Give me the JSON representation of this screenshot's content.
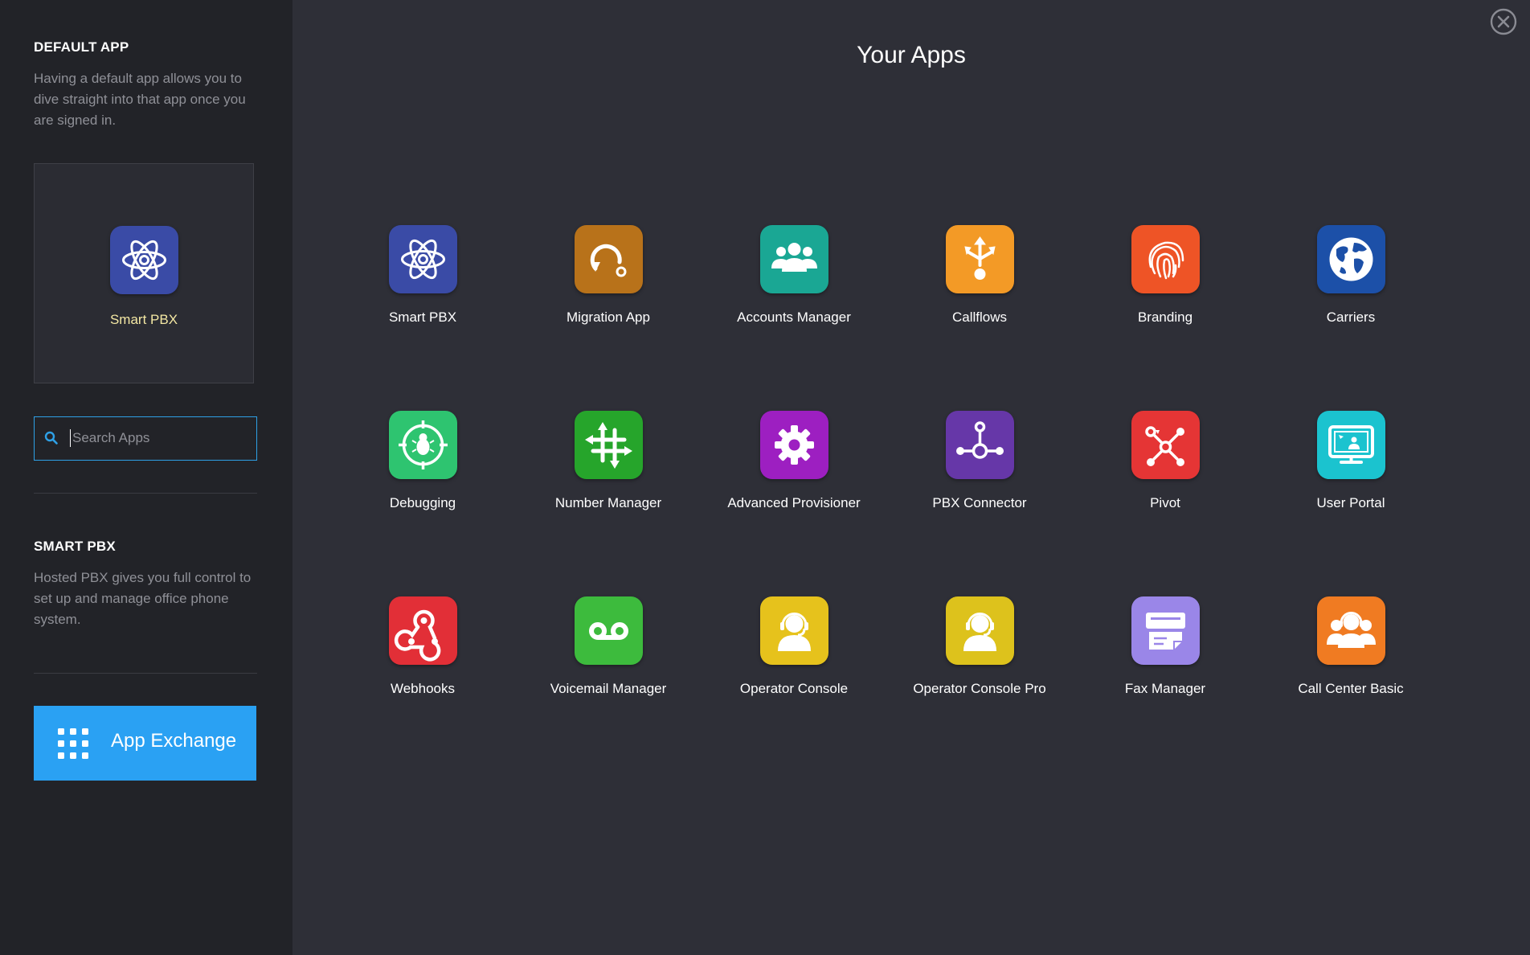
{
  "sidebar": {
    "default_heading": "DEFAULT APP",
    "default_description": "Having a default app allows you to dive straight into that app once you are signed in.",
    "default_app": {
      "label": "Smart PBX",
      "icon": "atom-icon",
      "color": "#3a4ba6"
    },
    "search": {
      "placeholder": "Search Apps",
      "value": ""
    },
    "info_heading": "SMART PBX",
    "info_description": "Hosted PBX gives you full control to set up and manage office phone system.",
    "exchange_label": "App Exchange"
  },
  "main": {
    "title": "Your Apps",
    "apps": [
      {
        "label": "Smart PBX",
        "icon": "atom-icon",
        "color": "#3a4ba6"
      },
      {
        "label": "Migration App",
        "icon": "migration-icon",
        "color": "#b8721a"
      },
      {
        "label": "Accounts Manager",
        "icon": "users-icon",
        "color": "#1aa794"
      },
      {
        "label": "Callflows",
        "icon": "callflow-icon",
        "color": "#f39a26"
      },
      {
        "label": "Branding",
        "icon": "fingerprint-icon",
        "color": "#ee5426"
      },
      {
        "label": "Carriers",
        "icon": "globe-icon",
        "color": "#1c50a8"
      },
      {
        "label": "Debugging",
        "icon": "bug-target-icon",
        "color": "#2ec470"
      },
      {
        "label": "Number Manager",
        "icon": "hash-icon",
        "color": "#26a52b"
      },
      {
        "label": "Advanced Provisioner",
        "icon": "gear-icon",
        "color": "#9d1fc1"
      },
      {
        "label": "PBX Connector",
        "icon": "connector-icon",
        "color": "#6637a8"
      },
      {
        "label": "Pivot",
        "icon": "pivot-icon",
        "color": "#e53535"
      },
      {
        "label": "User Portal",
        "icon": "portal-icon",
        "color": "#1bc3cf"
      },
      {
        "label": "Webhooks",
        "icon": "webhooks-icon",
        "color": "#e22f37"
      },
      {
        "label": "Voicemail Manager",
        "icon": "voicemail-icon",
        "color": "#3dbb3d"
      },
      {
        "label": "Operator Console",
        "icon": "operator-icon",
        "color": "#e6c21c"
      },
      {
        "label": "Operator Console Pro",
        "icon": "operator-icon",
        "color": "#ddc21c"
      },
      {
        "label": "Fax Manager",
        "icon": "fax-icon",
        "color": "#9a86e8"
      },
      {
        "label": "Call Center Basic",
        "icon": "callcenter-icon",
        "color": "#f07b22"
      }
    ]
  }
}
